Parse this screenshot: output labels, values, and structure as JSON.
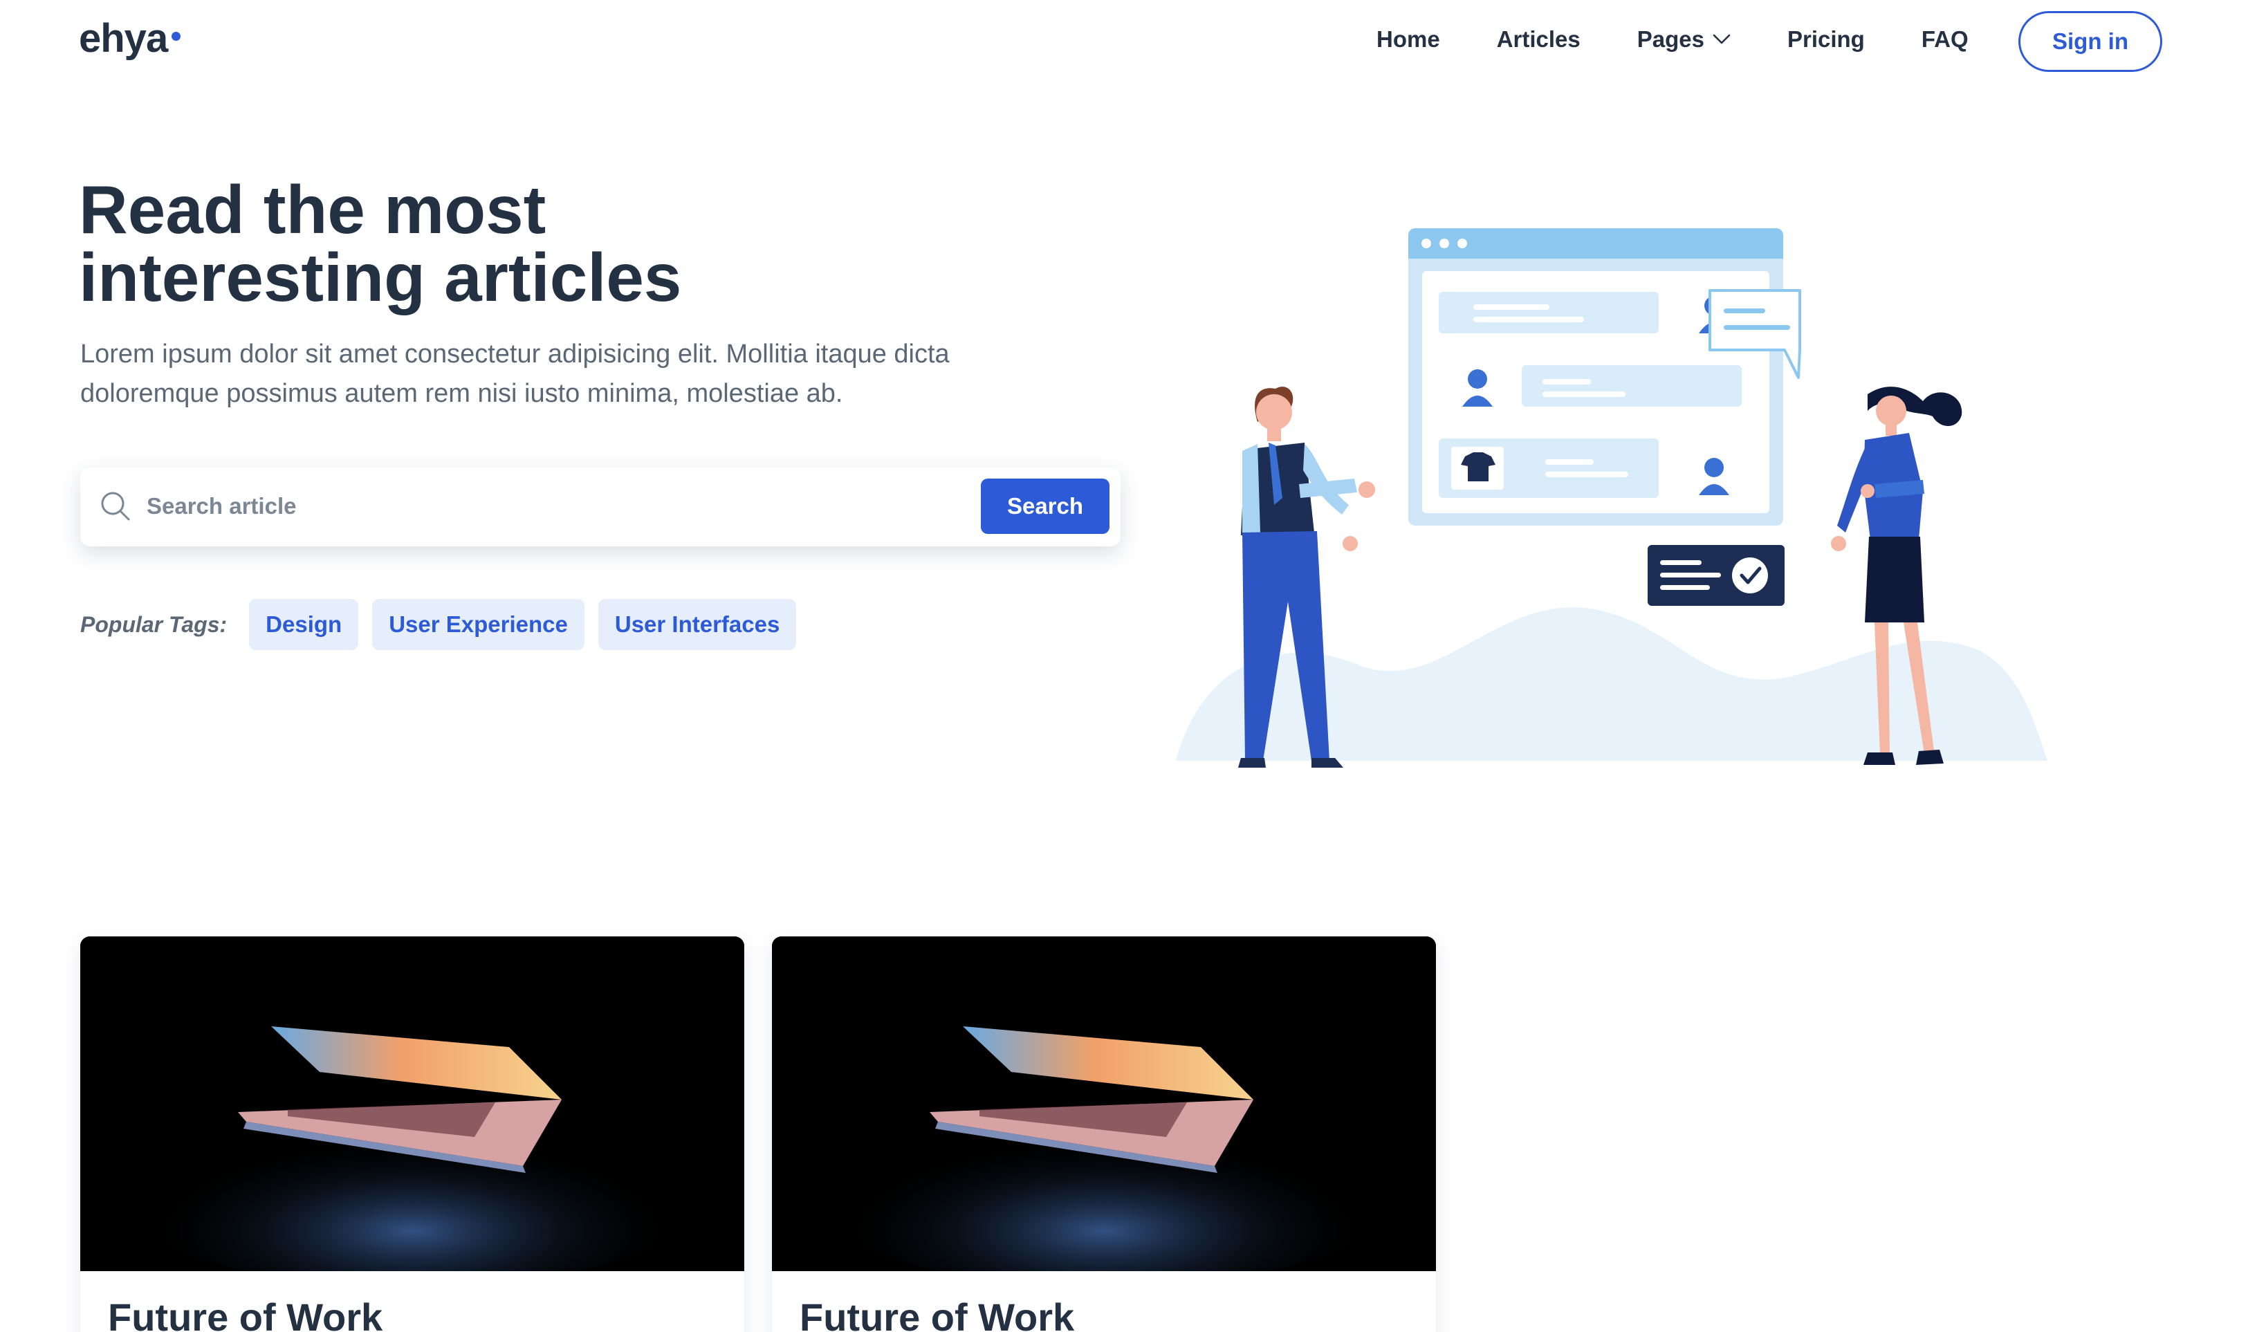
{
  "brand": {
    "logo_text": "ehya",
    "accent_color": "#2d5bd7",
    "text_color": "#243142"
  },
  "nav": {
    "items": [
      {
        "label": "Home"
      },
      {
        "label": "Articles"
      },
      {
        "label": "Pages",
        "has_dropdown": true
      },
      {
        "label": "Pricing"
      },
      {
        "label": "FAQ"
      }
    ],
    "signin_label": "Sign in"
  },
  "hero": {
    "title_line1": "Read the most",
    "title_line2": "interesting articles",
    "subtitle_line1": "Lorem ipsum dolor sit amet consectetur adipisicing elit. Mollitia itaque dicta",
    "subtitle_line2": "doloremque possimus autem rem nisi iusto minima, molestiae ab."
  },
  "search": {
    "placeholder": "Search article",
    "value": "",
    "button_label": "Search"
  },
  "tags": {
    "label": "Popular Tags:",
    "items": [
      "Design",
      "User Experience",
      "User Interfaces"
    ]
  },
  "cards": [
    {
      "title": "Future of Work",
      "image": "laptop-dark-photo"
    },
    {
      "title": "Future of Work",
      "image": "laptop-dark-photo"
    }
  ],
  "icons": {
    "search": "search-icon",
    "dropdown": "chevron-down-icon"
  }
}
